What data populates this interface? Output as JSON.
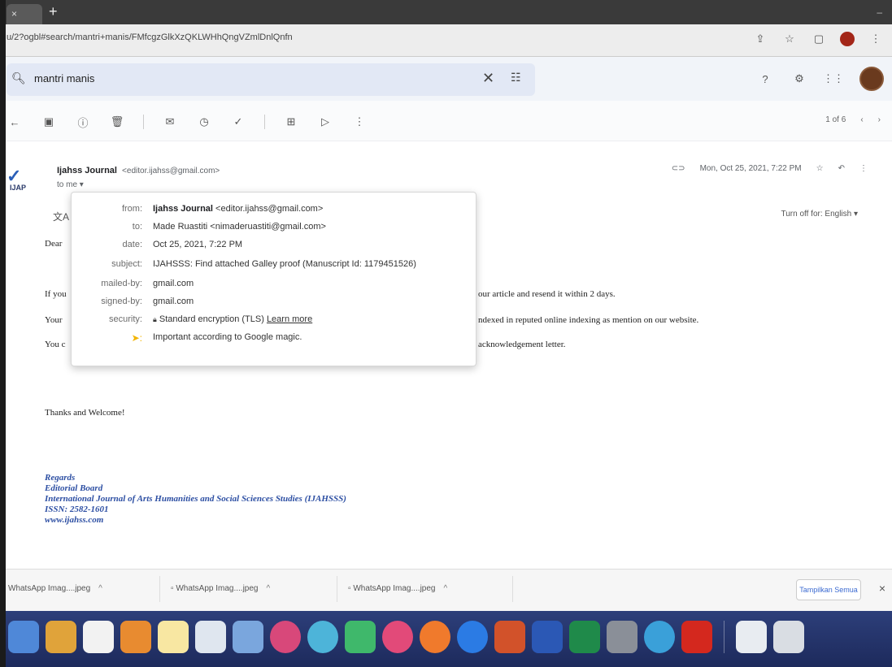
{
  "browser": {
    "tab_close": "×",
    "new_tab": "+",
    "tabstrip_right": "–",
    "url": "u/2?ogbl#search/mantri+manis/FMfcgzGlkXzQKLWHhQngVZmlDnlQnfn"
  },
  "search": {
    "query": "mantri manis",
    "clear": "✕",
    "tune": "⚙"
  },
  "toolbar": {
    "pager": "1 of 6"
  },
  "email": {
    "sender_name": "Ijahss Journal",
    "sender_addr": "<editor.ijahss@gmail.com>",
    "to_me": "to me ▾",
    "date_short": "Mon, Oct 25, 2021, 7:22 PM",
    "logo_abbr": "IJAP",
    "turn_off": "Turn off for: English ▾",
    "dear": "Dear",
    "line1_start": "If you",
    "line1_end": "our article and resend it within 2 days.",
    "line2_start": "Your",
    "line2_end": "ndexed in reputed online indexing as mention on our website.",
    "line3_start": "You c",
    "line3_end": "acknowledgement letter.",
    "thanks": "Thanks and Welcome!",
    "signature": [
      "Regards",
      "Editorial Board",
      "International Journal of Arts Humanities and Social Sciences Studies (IJAHSSS)",
      "ISSN: 2582-1601",
      "www.ijahss.com"
    ]
  },
  "details": {
    "from_label": "from:",
    "from_name": "Ijahss Journal",
    "from_addr": "<editor.ijahss@gmail.com>",
    "to_label": "to:",
    "to_value": "Made Ruastiti <nimaderuastiti@gmail.com>",
    "date_label": "date:",
    "date_value": "Oct 25, 2021, 7:22 PM",
    "subject_label": "subject:",
    "subject_value": "IJAHSSS: Find attached Galley proof (Manuscript Id: 1179451526)",
    "mailedby_label": "mailed-by:",
    "mailedby_value": "gmail.com",
    "signedby_label": "signed-by:",
    "signedby_value": "gmail.com",
    "security_label": "security:",
    "security_value": "Standard encryption (TLS)",
    "security_link": "Learn more",
    "importance_value": "Important according to Google magic."
  },
  "downloads": {
    "items": [
      "WhatsApp Imag....jpeg",
      "WhatsApp Imag....jpeg",
      "WhatsApp Imag....jpeg"
    ],
    "show_all": "Tampilkan Semua",
    "close": "×"
  },
  "colors": {
    "signature": "#2d4fa3",
    "dock": "#2d3f7a",
    "importance": "#f2b400"
  }
}
